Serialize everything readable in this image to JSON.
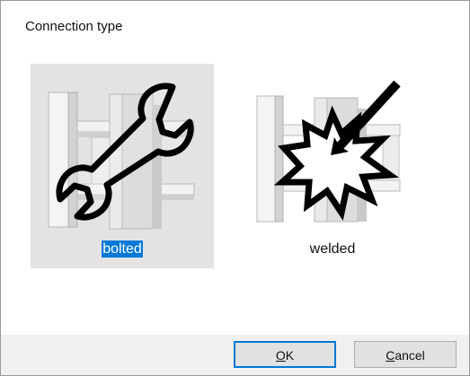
{
  "dialog": {
    "title": "Connection type"
  },
  "options": [
    {
      "label": "bolted",
      "icon": "wrench-icon",
      "selected": true
    },
    {
      "label": "welded",
      "icon": "weld-spark-icon",
      "selected": false
    }
  ],
  "buttons": {
    "ok_label": "OK",
    "ok_mnemonic": "O",
    "ok_rest": "K",
    "cancel_label": "Cancel",
    "cancel_mnemonic": "C",
    "cancel_rest": "ancel"
  },
  "colors": {
    "selection": "#0078d7",
    "selected_tile": "#e3e3e3",
    "footer": "#f0f0f0"
  }
}
